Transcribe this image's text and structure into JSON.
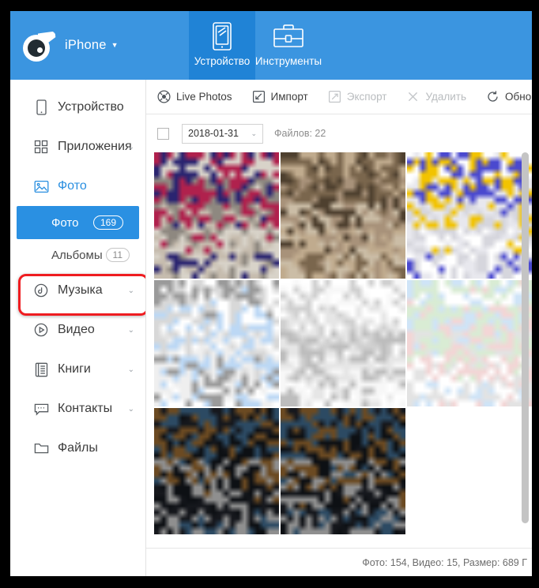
{
  "window": {
    "device_name": "iPhone",
    "device_caret": "▼",
    "logo_icon": "tadpole-eye-logo-icon"
  },
  "top_tabs": [
    {
      "label": "Устройство",
      "icon": "tablet-device-icon",
      "active": true
    },
    {
      "label": "Инструменты",
      "icon": "briefcase-toolbox-icon",
      "active": false
    }
  ],
  "sidebar": {
    "items": [
      {
        "label": "Устройство",
        "icon": "phone-icon",
        "caret": "",
        "selected": false
      },
      {
        "label": "Приложения",
        "icon": "apps-grid-icon",
        "caret": "⌄",
        "selected": false
      },
      {
        "label": "Фото",
        "icon": "photo-image-icon",
        "caret": "",
        "selected": true
      },
      {
        "label": "Музыка",
        "icon": "music-disc-icon",
        "caret": "⌄",
        "selected": false
      },
      {
        "label": "Видео",
        "icon": "video-play-icon",
        "caret": "⌄",
        "selected": false
      },
      {
        "label": "Книги",
        "icon": "book-icon",
        "caret": "⌄",
        "selected": false
      },
      {
        "label": "Контакты",
        "icon": "contacts-card-icon",
        "caret": "⌄",
        "selected": false
      },
      {
        "label": "Файлы",
        "icon": "folder-icon",
        "caret": "",
        "selected": false
      }
    ],
    "photo_sub_items": [
      {
        "label": "Фото",
        "badge": "169",
        "active": true
      },
      {
        "label": "Альбомы",
        "badge": "11",
        "active": false
      }
    ]
  },
  "toolbar": {
    "buttons": [
      {
        "label": "Live Photos",
        "icon": "live-photos-icon",
        "disabled": false
      },
      {
        "label": "Импорт",
        "icon": "import-arrow-icon",
        "disabled": false
      },
      {
        "label": "Экспорт",
        "icon": "export-arrow-icon",
        "disabled": true
      },
      {
        "label": "Удалить",
        "icon": "delete-cross-icon",
        "disabled": true
      },
      {
        "label": "Обновить",
        "icon": "refresh-icon",
        "disabled": false
      }
    ]
  },
  "filter_bar": {
    "select_all_checked": false,
    "date_value": "2018-01-31",
    "date_caret": "⌄",
    "file_count_label": "Файлов: 22"
  },
  "status_bar": {
    "text": "Фото: 154, Видео: 15, Размер: 689 Г"
  },
  "colors": {
    "header_blue": "#3b95e0",
    "active_tab_blue": "#2083d6",
    "accent_blue": "#2a90e2",
    "highlight_red": "#ef1c20",
    "text_dark": "#3c3c3c",
    "text_muted": "#8d8d8d",
    "disabled_gray": "#b9bcbf"
  },
  "photo_grid": {
    "thumbnails": [
      {
        "name": "thumb-laptop-screen-red",
        "palette": [
          "#d8d3c9",
          "#2a2470",
          "#b0214d",
          "#8e8880",
          "#c6bcae"
        ],
        "seed": 11
      },
      {
        "name": "thumb-keyboard-closeup",
        "palette": [
          "#c0ab8e",
          "#7a664d",
          "#4e402f",
          "#a8927a",
          "#cbbda6"
        ],
        "seed": 27
      },
      {
        "name": "thumb-webpage-colorful",
        "palette": [
          "#ffffff",
          "#4a49cf",
          "#f2c300",
          "#e8e8ee",
          "#d6d6dd"
        ],
        "seed": 41
      },
      {
        "name": "thumb-window-dialog-gray",
        "palette": [
          "#9a9a9a",
          "#ffffff",
          "#d8d8d8",
          "#bcd8f5",
          "#efefef"
        ],
        "seed": 53
      },
      {
        "name": "thumb-document-text-white",
        "palette": [
          "#f7f7f7",
          "#ffffff",
          "#d0d0d0",
          "#e6e6e6",
          "#bdbdbd"
        ],
        "seed": 67
      },
      {
        "name": "thumb-list-items-pastel",
        "palette": [
          "#ffffff",
          "#cfe4f7",
          "#d9ecd4",
          "#f3d6d6",
          "#e3e3e3"
        ],
        "seed": 79
      },
      {
        "name": "thumb-dark-shelf-photo-a",
        "palette": [
          "#16181d",
          "#2c4a63",
          "#6b4a22",
          "#0d1014",
          "#8f8f8f"
        ],
        "seed": 91
      },
      {
        "name": "thumb-dark-shelf-photo-b",
        "palette": [
          "#16181d",
          "#2c4a63",
          "#6b4a22",
          "#0d1014",
          "#8f8f8f"
        ],
        "seed": 103
      }
    ]
  }
}
